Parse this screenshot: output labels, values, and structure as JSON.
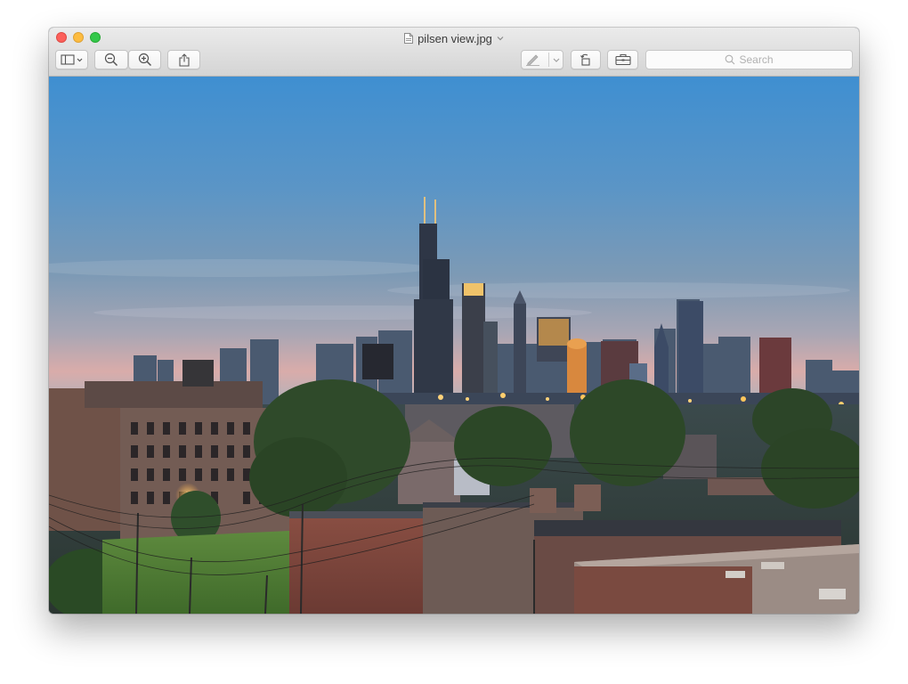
{
  "window": {
    "title": "pilsen view.jpg"
  },
  "toolbar": {
    "sidebar_button": "sidebar-toggle",
    "zoom_out": "zoom-out",
    "zoom_in": "zoom-in",
    "share": "share",
    "markup": "markup",
    "rotate": "rotate-left",
    "toolbox": "markup-toolbox"
  },
  "search": {
    "placeholder": "Search"
  },
  "document": {
    "kind": "photo",
    "subject_colors": {
      "sky_top": "#3f8fd1",
      "sky_horizon": "#e9b6a8",
      "window_light": "#f4b860"
    }
  }
}
